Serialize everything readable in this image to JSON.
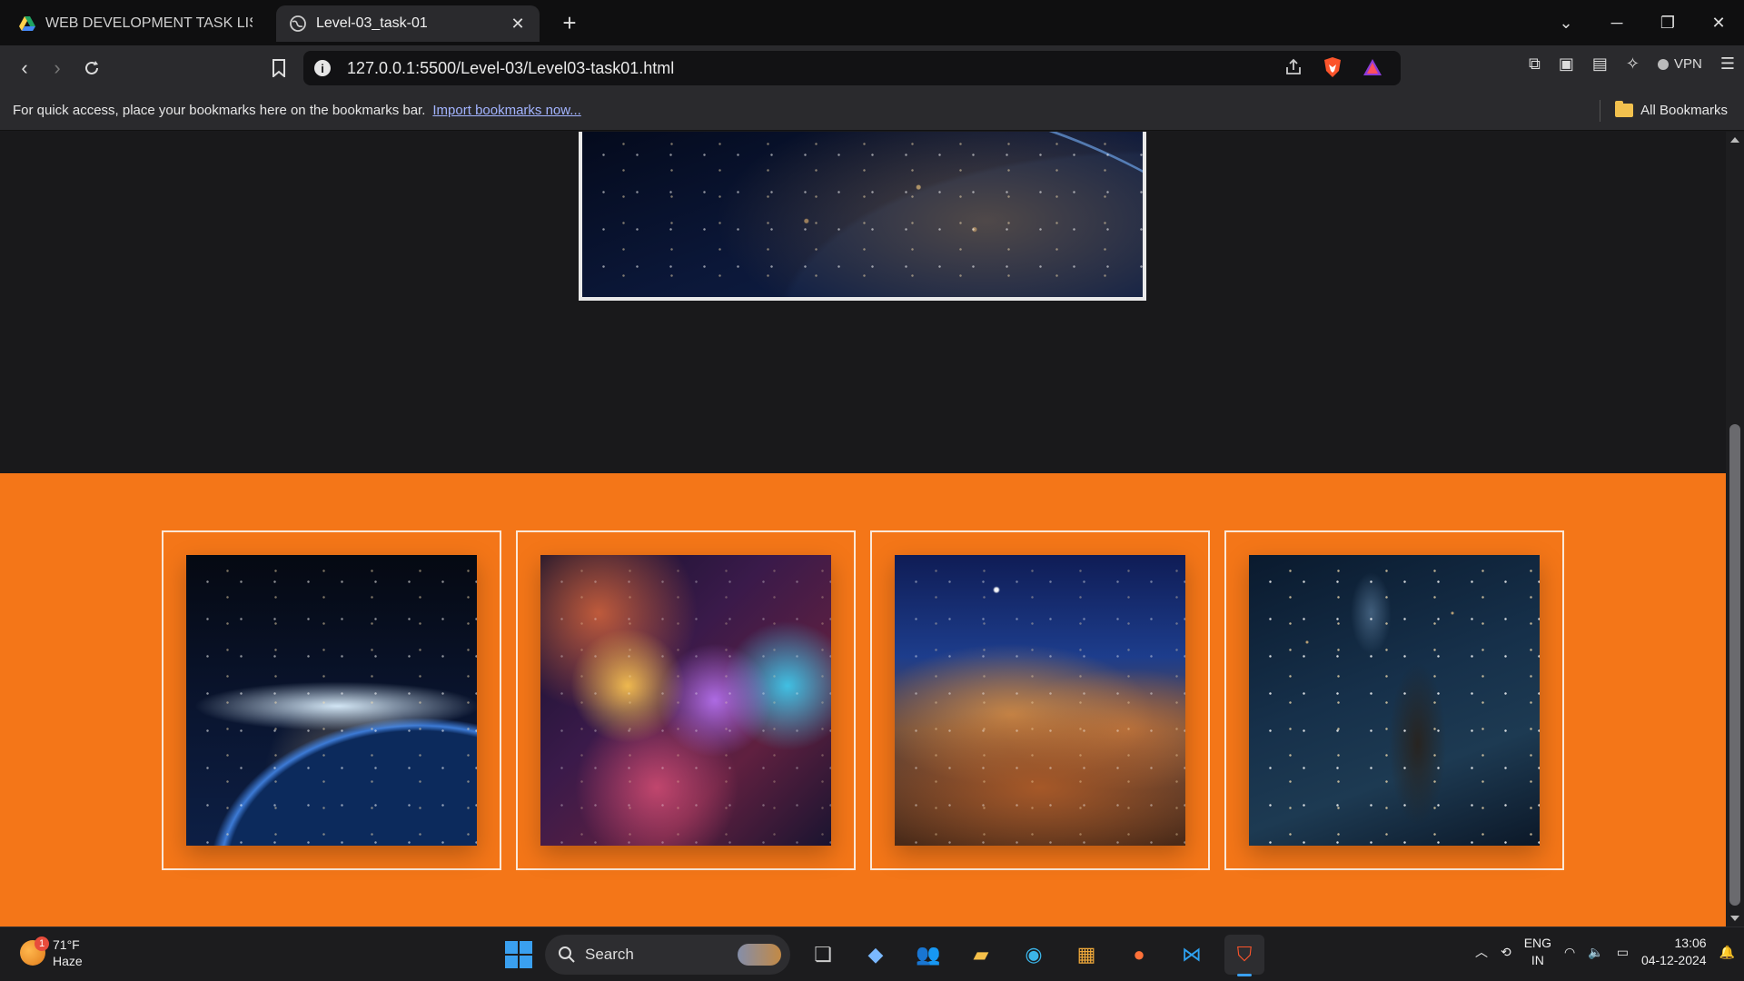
{
  "browser": {
    "tabs": [
      {
        "title": "WEB DEVELOPMENT TASK LIST - Go",
        "active": false,
        "favicon": "google-drive-icon"
      },
      {
        "title": "Level-03_task-01",
        "active": true,
        "favicon": "globe-icon"
      }
    ],
    "close_tab_glyph": "✕",
    "new_tab_glyph": "+",
    "url": "127.0.0.1:5500/Level-03/Level03-task01.html",
    "vpn_label": "VPN",
    "bookmarks_bar": {
      "message": "For quick access, place your bookmarks here on the bookmarks bar.",
      "import_link": "Import bookmarks now...",
      "all_bookmarks": "All Bookmarks"
    }
  },
  "page": {
    "hero_image": "earth-night-europe-image",
    "section_color": "#f47618",
    "gallery": [
      {
        "image": "earth-horizon-space-image"
      },
      {
        "image": "colorful-nebula-image"
      },
      {
        "image": "carina-nebula-cliffs-image"
      },
      {
        "image": "pillars-of-creation-image"
      }
    ]
  },
  "taskbar": {
    "weather": {
      "temp": "71°F",
      "condition": "Haze",
      "badge": "1"
    },
    "search_placeholder": "Search",
    "lang_primary": "ENG",
    "lang_secondary": "IN",
    "time": "13:06",
    "date": "04-12-2024"
  },
  "colors": {
    "accent": "#f47618",
    "chrome": "#2a2a2d",
    "page_bg": "#19191b"
  }
}
